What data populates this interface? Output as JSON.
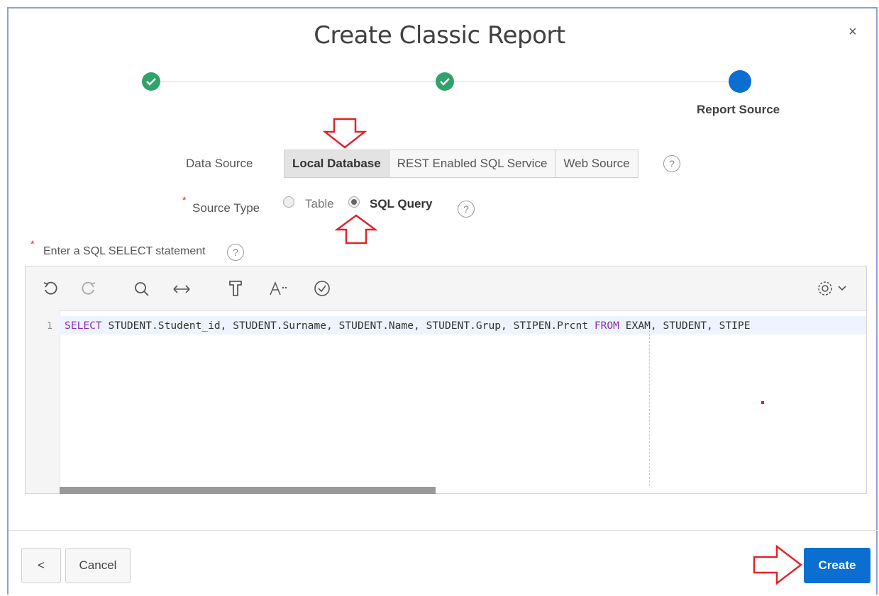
{
  "dialog": {
    "title": "Create Classic Report",
    "close_label": "×"
  },
  "wizard": {
    "steps": [
      {
        "status": "complete"
      },
      {
        "status": "complete"
      },
      {
        "status": "current",
        "label": "Report Source"
      }
    ]
  },
  "form": {
    "data_source_label": "Data Source",
    "data_source_options": [
      "Local Database",
      "REST Enabled SQL Service",
      "Web Source"
    ],
    "data_source_selected": "Local Database",
    "source_type_label": "Source Type",
    "source_type_options": [
      "Table",
      "SQL Query"
    ],
    "source_type_selected": "SQL Query",
    "sql_label": "Enter a SQL SELECT statement",
    "required_mark": "*",
    "help_glyph": "?"
  },
  "editor": {
    "toolbar_icons": [
      "undo-icon",
      "redo-icon",
      "search-icon",
      "replace-icon",
      "format-icon",
      "font-size-icon",
      "validate-icon",
      "settings-icon"
    ],
    "line_number": "1",
    "code_keyword_select": "SELECT",
    "code_part1": " STUDENT.Student_id, STUDENT.Surname, STUDENT.Name, STUDENT.Grup, STIPEN.Prcnt ",
    "code_keyword_from": "FROM",
    "code_part2": " EXAM, STUDENT, STIPE"
  },
  "footer": {
    "back_label": "<",
    "cancel_label": "Cancel",
    "create_label": "Create"
  },
  "colors": {
    "primary": "#0a6fd1",
    "success": "#2fa36b",
    "annotation_red": "#e0242d"
  }
}
